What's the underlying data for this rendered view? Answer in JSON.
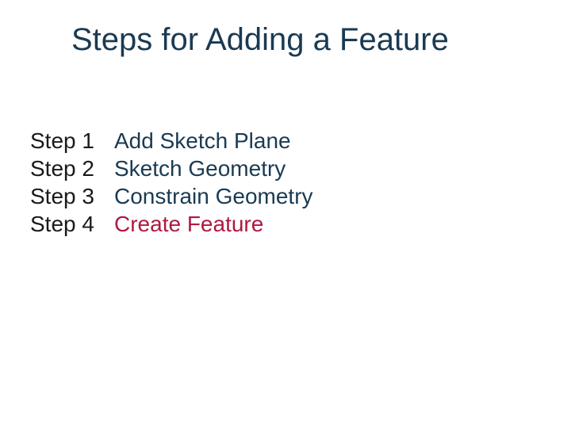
{
  "title": "Steps for Adding a Feature",
  "steps": [
    {
      "label": "Step 1",
      "desc": "Add Sketch Plane",
      "colorClass": "color-dark"
    },
    {
      "label": "Step 2",
      "desc": "Sketch Geometry",
      "colorClass": "color-dark"
    },
    {
      "label": "Step 3",
      "desc": "Constrain Geometry",
      "colorClass": "color-dark"
    },
    {
      "label": "Step 4",
      "desc": "Create Feature",
      "colorClass": "color-crimson"
    }
  ]
}
